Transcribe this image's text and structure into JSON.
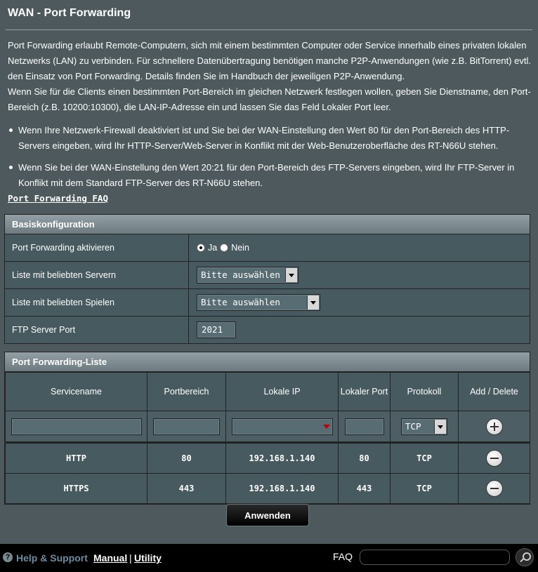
{
  "page": {
    "title": "WAN - Port Forwarding",
    "desc_p1": "Port Forwarding erlaubt Remote-Computern, sich mit einem bestimmten Computer oder Service innerhalb eines privaten lokalen Netzwerks (LAN) zu verbinden. Für schnellere Datenübertragung benötigen manche P2P-Anwendungen (wie z.B. BitTorrent) evtl. den Einsatz von Port Forwarding. Details finden Sie im Handbuch der jeweiligen P2P-Anwendung.",
    "desc_p2": "Wenn Sie für die Clients einen bestimmten Port-Bereich im gleichen Netzwerk festlegen wollen, geben Sie Dienstname, den Port-Bereich (z.B. 10200:10300), die LAN-IP-Adresse ein und lassen Sie das Feld Lokaler Port leer.",
    "bullets": [
      "Wenn Ihre Netzwerk-Firewall deaktiviert ist und Sie bei der WAN-Einstellung den Wert 80 für den Port-Bereich des HTTP-Servers eingeben, wird Ihr HTTP-Server/Web-Server in Konflikt mit der Web-Benutzeroberfläche des RT-N66U stehen.",
      "Wenn Sie bei der WAN-Einstellung den Wert 20:21 für den Port-Bereich des FTP-Servers eingeben, wird Ihr FTP-Server in Konflikt mit dem Standard FTP-Server des RT-N66U stehen."
    ],
    "faq_link": "Port Forwarding FAQ"
  },
  "basic": {
    "header": "Basiskonfiguration",
    "enable_label": "Port Forwarding aktivieren",
    "radio_yes": "Ja",
    "radio_no": "Nein",
    "radio_selected": "Ja",
    "servers_label": "Liste mit beliebten Servern",
    "servers_value": "Bitte auswählen",
    "games_label": "Liste mit beliebten Spielen",
    "games_value": "Bitte auswählen",
    "ftp_label": "FTP Server Port",
    "ftp_value": "2021"
  },
  "list": {
    "header": "Port Forwarding-Liste",
    "columns": [
      "Servicename",
      "Portbereich",
      "Lokale IP",
      "Lokaler Port",
      "Protokoll",
      "Add / Delete"
    ],
    "new_protocol": "TCP",
    "rows": [
      {
        "name": "HTTP",
        "range": "80",
        "ip": "192.168.1.140",
        "port": "80",
        "protocol": "TCP"
      },
      {
        "name": "HTTPS",
        "range": "443",
        "ip": "192.168.1.140",
        "port": "443",
        "protocol": "TCP"
      }
    ]
  },
  "apply_label": "Anwenden",
  "footer": {
    "help_label": "Help & Support",
    "manual": "Manual",
    "separator": "|",
    "utility": "Utility",
    "faq": "FAQ",
    "faq_placeholder": ""
  }
}
